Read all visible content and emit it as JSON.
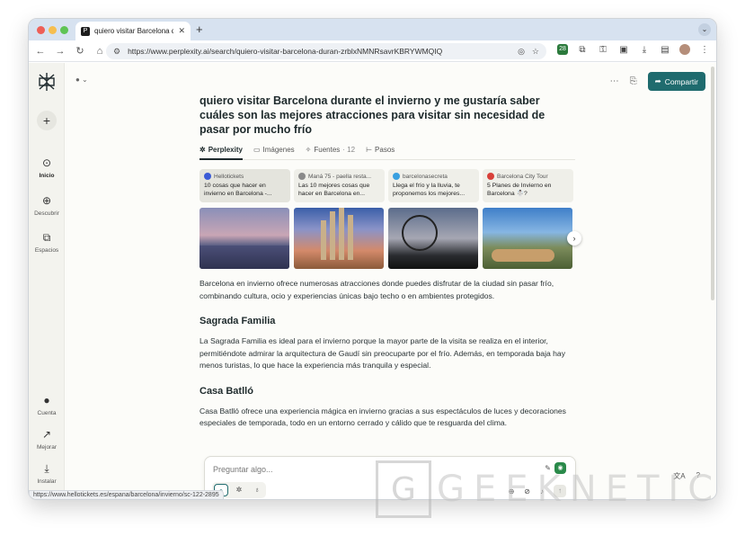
{
  "browser": {
    "tab_title": "quiero visitar Barcelona durante",
    "tab_favicon": "P",
    "new_tab": "+",
    "url": "https://www.perplexity.ai/search/quiero-visitar-barcelona-duran-zrblxNMNRsavrKBRYWMQIQ",
    "extension_badge": "28"
  },
  "sidebar": {
    "new_label": "+",
    "items": [
      {
        "label": "Inicio",
        "icon": "home-search-icon"
      },
      {
        "label": "Descubrir",
        "icon": "globe-icon"
      },
      {
        "label": "Espacios",
        "icon": "spaces-icon"
      }
    ],
    "bottom": [
      {
        "label": "Cuenta",
        "icon": "account-icon"
      },
      {
        "label": "Mejorar",
        "icon": "upgrade-icon"
      },
      {
        "label": "Instalar",
        "icon": "install-icon"
      }
    ]
  },
  "header": {
    "share_label": "Compartir"
  },
  "thread": {
    "query": "quiero visitar Barcelona durante el invierno y me gustaría saber cuáles son las mejores atracciones para visitar sin necesidad de pasar por mucho frío",
    "tabs": [
      {
        "label": "Perplexity",
        "icon": "perplexity-icon"
      },
      {
        "label": "Imágenes",
        "icon": "image-icon"
      },
      {
        "label": "Fuentes",
        "icon": "sources-icon",
        "count": "· 12"
      },
      {
        "label": "Pasos",
        "icon": "steps-icon"
      }
    ],
    "sources": [
      {
        "site": "Hellotickets",
        "title": "10 cosas que hacer en invierno en Barcelona -...",
        "color": "#3b5bd6"
      },
      {
        "site": "Maná 75 - paella resta...",
        "title": "Las 10 mejores cosas que hacer en Barcelona en...",
        "color": "#8a8a8a"
      },
      {
        "site": "barcelonasecreta",
        "title": "Llega el frío y la lluvia, te proponemos los mejores...",
        "color": "#3aa0e0"
      },
      {
        "site": "Barcelona City Tour",
        "title": "5 Planes de Invierno en Barcelona ☃️?",
        "color": "#d8403a"
      }
    ],
    "intro": "Barcelona en invierno ofrece numerosas atracciones donde puedes disfrutar de la ciudad sin pasar frío, combinando cultura, ocio y experiencias únicas bajo techo o en ambientes protegidos.",
    "sections": [
      {
        "heading": "Sagrada Familia",
        "body": "La Sagrada Familia es ideal para el invierno porque la mayor parte de la visita se realiza en el interior, permitiéndote admirar la arquitectura de Gaudí sin preocuparte por el frío. Además, en temporada baja hay menos turistas, lo que hace la experiencia más tranquila y especial."
      },
      {
        "heading": "Casa Batlló",
        "body": "Casa Batlló ofrece una experiencia mágica en invierno gracias a sus espectáculos de luces y decoraciones especiales de temporada, todo en un entorno cerrado y cálido que te resguarda del clima."
      }
    ]
  },
  "ask": {
    "placeholder": "Preguntar algo..."
  },
  "status_url": "https://www.hellotickets.es/espana/barcelona/invierno/sc-122-2895",
  "watermark": {
    "letter": "G",
    "word": "GEEKNETIC"
  }
}
